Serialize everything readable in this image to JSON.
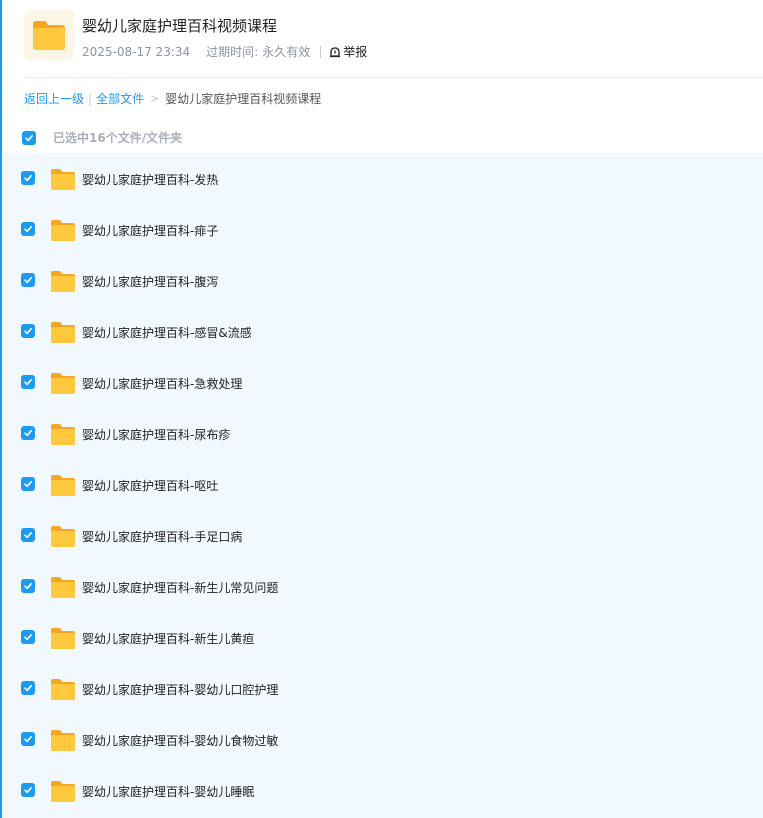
{
  "header": {
    "icon": "folder-icon",
    "title": "婴幼儿家庭护理百科视频课程",
    "date": "2025-08-17 23:34",
    "expire_label": "过期时间:",
    "expire_value": "永久有效",
    "report_icon": "report-icon",
    "report_label": "举报"
  },
  "breadcrumb": {
    "back": "返回上一级",
    "all": "全部文件",
    "current": "婴幼儿家庭护理百科视频课程"
  },
  "selection": {
    "text": "已选中16个文件/文件夹",
    "checked": true
  },
  "colors": {
    "accent": "#1e9bf0",
    "folder": "#ffc83d",
    "list_bg": "#f1f8fe"
  },
  "files": [
    {
      "name": "婴幼儿家庭护理百科-发热",
      "checked": true
    },
    {
      "name": "婴幼儿家庭护理百科-痱子",
      "checked": true
    },
    {
      "name": "婴幼儿家庭护理百科-腹泻",
      "checked": true
    },
    {
      "name": "婴幼儿家庭护理百科-感冒&流感",
      "checked": true
    },
    {
      "name": "婴幼儿家庭护理百科-急救处理",
      "checked": true
    },
    {
      "name": "婴幼儿家庭护理百科-尿布疹",
      "checked": true
    },
    {
      "name": "婴幼儿家庭护理百科-呕吐",
      "checked": true
    },
    {
      "name": "婴幼儿家庭护理百科-手足口病",
      "checked": true
    },
    {
      "name": "婴幼儿家庭护理百科-新生儿常见问题",
      "checked": true
    },
    {
      "name": "婴幼儿家庭护理百科-新生儿黄疸",
      "checked": true
    },
    {
      "name": "婴幼儿家庭护理百科-婴幼儿口腔护理",
      "checked": true
    },
    {
      "name": "婴幼儿家庭护理百科-婴幼儿食物过敏",
      "checked": true
    },
    {
      "name": "婴幼儿家庭护理百科-婴幼儿睡眠",
      "checked": true
    }
  ]
}
